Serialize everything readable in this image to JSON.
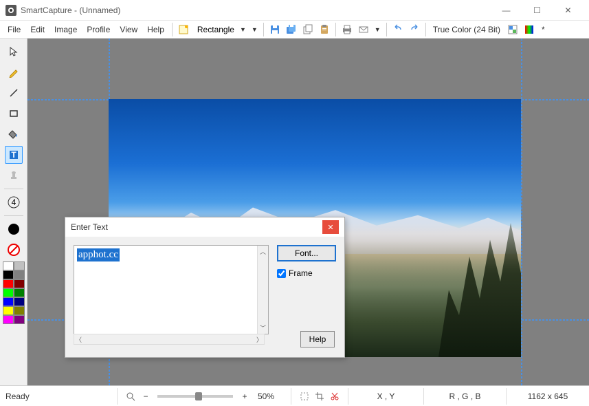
{
  "window": {
    "title": "SmartCapture - (Unnamed)",
    "minimize": "—",
    "maximize": "☐",
    "close": "✕"
  },
  "menubar": {
    "file": "File",
    "edit": "Edit",
    "image": "Image",
    "profile": "Profile",
    "view": "View",
    "help": "Help"
  },
  "toolbar": {
    "capture_mode": "Rectangle",
    "color_mode": "True Color (24 Bit)",
    "modified": "*",
    "icons": {
      "capture": "capture-icon",
      "save": "save-icon",
      "save_all": "save-all-icon",
      "copy": "copy-icon",
      "paste": "paste-icon",
      "print": "print-icon",
      "email": "email-icon",
      "undo": "undo-icon",
      "redo": "redo-icon",
      "palette1": "color-picker-icon",
      "palette2": "color-swap-icon"
    }
  },
  "palette": {
    "tools": [
      "pointer",
      "pencil",
      "line",
      "rectangle",
      "fill",
      "text",
      "stamp"
    ],
    "selected": "text",
    "line_weight": "4",
    "colors_top": [
      "#ffffff",
      "#c0c0c0"
    ],
    "colors": [
      "#000000",
      "#808080",
      "#ff0000",
      "#800000",
      "#00ff00",
      "#008000",
      "#0000ff",
      "#000080",
      "#ffff00",
      "#808000",
      "#ff00ff",
      "#800080"
    ]
  },
  "canvas": {
    "image_desc": "Mountain landscape with snowy peaks and blue sky"
  },
  "dialog": {
    "title": "Enter Text",
    "text_value": "apphot.cc",
    "font_btn": "Font...",
    "frame_label": "Frame",
    "frame_checked": true,
    "help_btn": "Help"
  },
  "statusbar": {
    "ready": "Ready",
    "zoom": "50%",
    "xy": "X , Y",
    "rgb": "R , G , B",
    "dims": "1162 x 645",
    "icons": {
      "zoom": "magnifier-icon",
      "selection": "selection-icon",
      "crop": "crop-icon",
      "cut": "scissors-icon"
    }
  }
}
